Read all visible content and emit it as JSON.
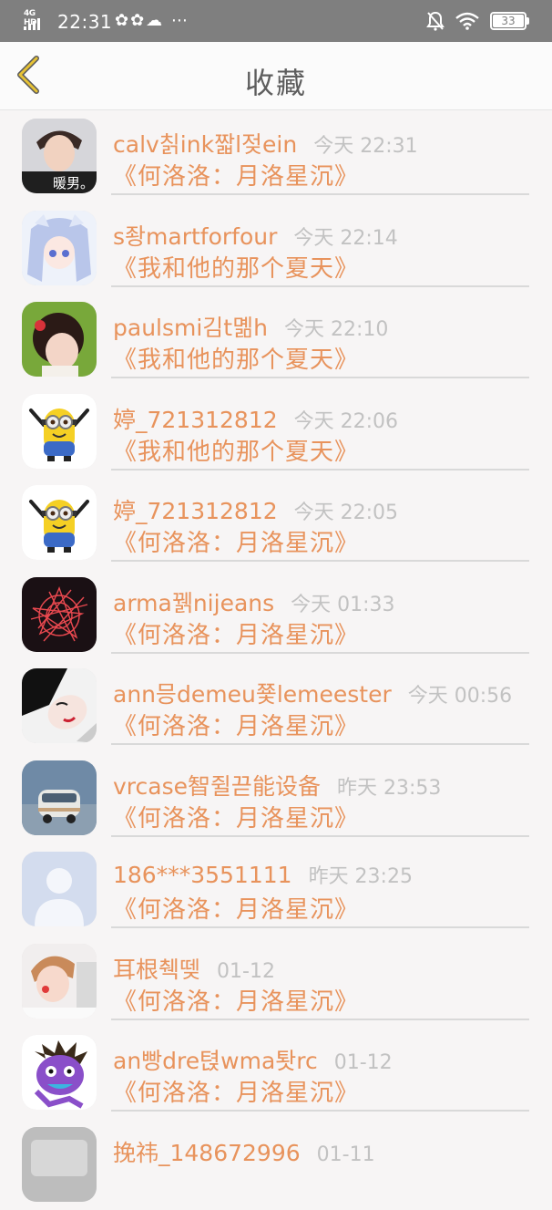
{
  "status_bar": {
    "network": "4G HD",
    "time": "22:31",
    "app_icons": "✿✿☁ ⋯",
    "battery": "33"
  },
  "header": {
    "title": "收藏"
  },
  "favorites": [
    {
      "name": "calv칡ink짧l젖ein",
      "time": "今天 22:31",
      "book": "《何洛洛：月洛星沉》",
      "avatar": "boy-photo-icon",
      "avatar_caption": "暖男。"
    },
    {
      "name": "s좡martforfour",
      "time": "今天 22:14",
      "book": "《我和他的那个夏天》",
      "avatar": "anime-girl-icon"
    },
    {
      "name": "paulsmi김t몖h",
      "time": "今天 22:10",
      "book": "《我和他的那个夏天》",
      "avatar": "girl-photo-icon"
    },
    {
      "name": "婷_721312812",
      "time": "今天 22:06",
      "book": "《我和他的那个夏天》",
      "avatar": "minion-icon"
    },
    {
      "name": "婷_721312812",
      "time": "今天 22:05",
      "book": "《何洛洛：月洛星沉》",
      "avatar": "minion-icon"
    },
    {
      "name": "arma꿹nijeans",
      "time": "今天 01:33",
      "book": "《何洛洛：月洛星沉》",
      "avatar": "red-burst-icon"
    },
    {
      "name": "ann믕demeu쭃lemeester",
      "time": "今天 00:56",
      "book": "《何洛洛：月洛星沉》",
      "avatar": "woman-sketch-icon"
    },
    {
      "name": "vrcase智쥘끋能设备",
      "time": "昨天 23:53",
      "book": "《何洛洛：月洛星沉》",
      "avatar": "van-photo-icon"
    },
    {
      "name": "186***3551111",
      "time": "昨天 23:25",
      "book": "《何洛洛：月洛星沉》",
      "avatar": "default-avatar-icon"
    },
    {
      "name": "耳根췍뗒",
      "time": "01-12",
      "book": "《何洛洛：月洛星沉》",
      "avatar": "idol-photo-icon"
    },
    {
      "name": "an빵dre텭wma퇏rc",
      "time": "01-12",
      "book": "《何洛洛：月洛星沉》",
      "avatar": "purple-monster-icon"
    },
    {
      "name": "挽祎_148672996",
      "time": "01-11",
      "book": "",
      "avatar": "gray-photo-icon"
    }
  ],
  "colors": {
    "accent": "#e8935c",
    "timestamp": "#c2c2c2",
    "title": "#5e5e5e",
    "back_arrow": "#e6c235",
    "status_bar": "#7f7f7f"
  }
}
